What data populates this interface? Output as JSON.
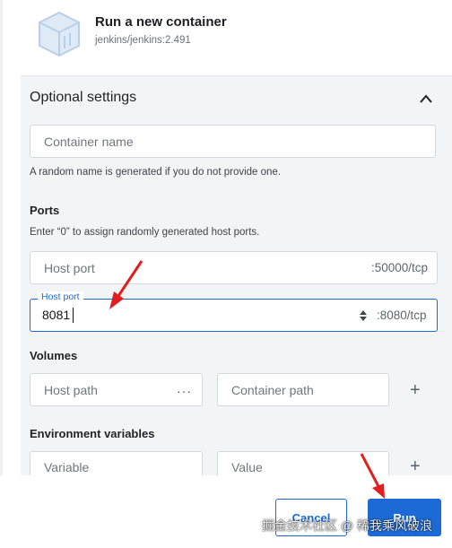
{
  "header": {
    "title": "Run a new container",
    "image": "jenkins/jenkins:2.491",
    "icon": "container-cube-icon"
  },
  "optional_settings": {
    "title": "Optional settings",
    "collapse_icon": "chevron-up-icon",
    "container_name": {
      "placeholder": "Container name",
      "value": "",
      "helper": "A random name is generated if you do not provide one."
    }
  },
  "ports": {
    "title": "Ports",
    "helper": "Enter “0” to assign randomly generated host ports.",
    "rows": [
      {
        "placeholder": "Host port",
        "value": "",
        "container_port": ":50000/tcp"
      },
      {
        "label": "Host port",
        "value": "8081",
        "container_port": ":8080/tcp",
        "focused": true
      }
    ]
  },
  "volumes": {
    "title": "Volumes",
    "host_path_placeholder": "Host path",
    "browse_label": "···",
    "container_path_placeholder": "Container path",
    "add_label": "+"
  },
  "env": {
    "title": "Environment variables",
    "variable_placeholder": "Variable",
    "value_placeholder": "Value",
    "add_label": "+"
  },
  "footer": {
    "cancel_label": "Cancel",
    "run_label": "Run"
  },
  "watermark": "掘金技术社区 @ 稀我乘风破浪",
  "colors": {
    "accent": "#1c6ad6",
    "annotation_arrow": "#e02020",
    "panel_background": "#f3f4f6"
  }
}
